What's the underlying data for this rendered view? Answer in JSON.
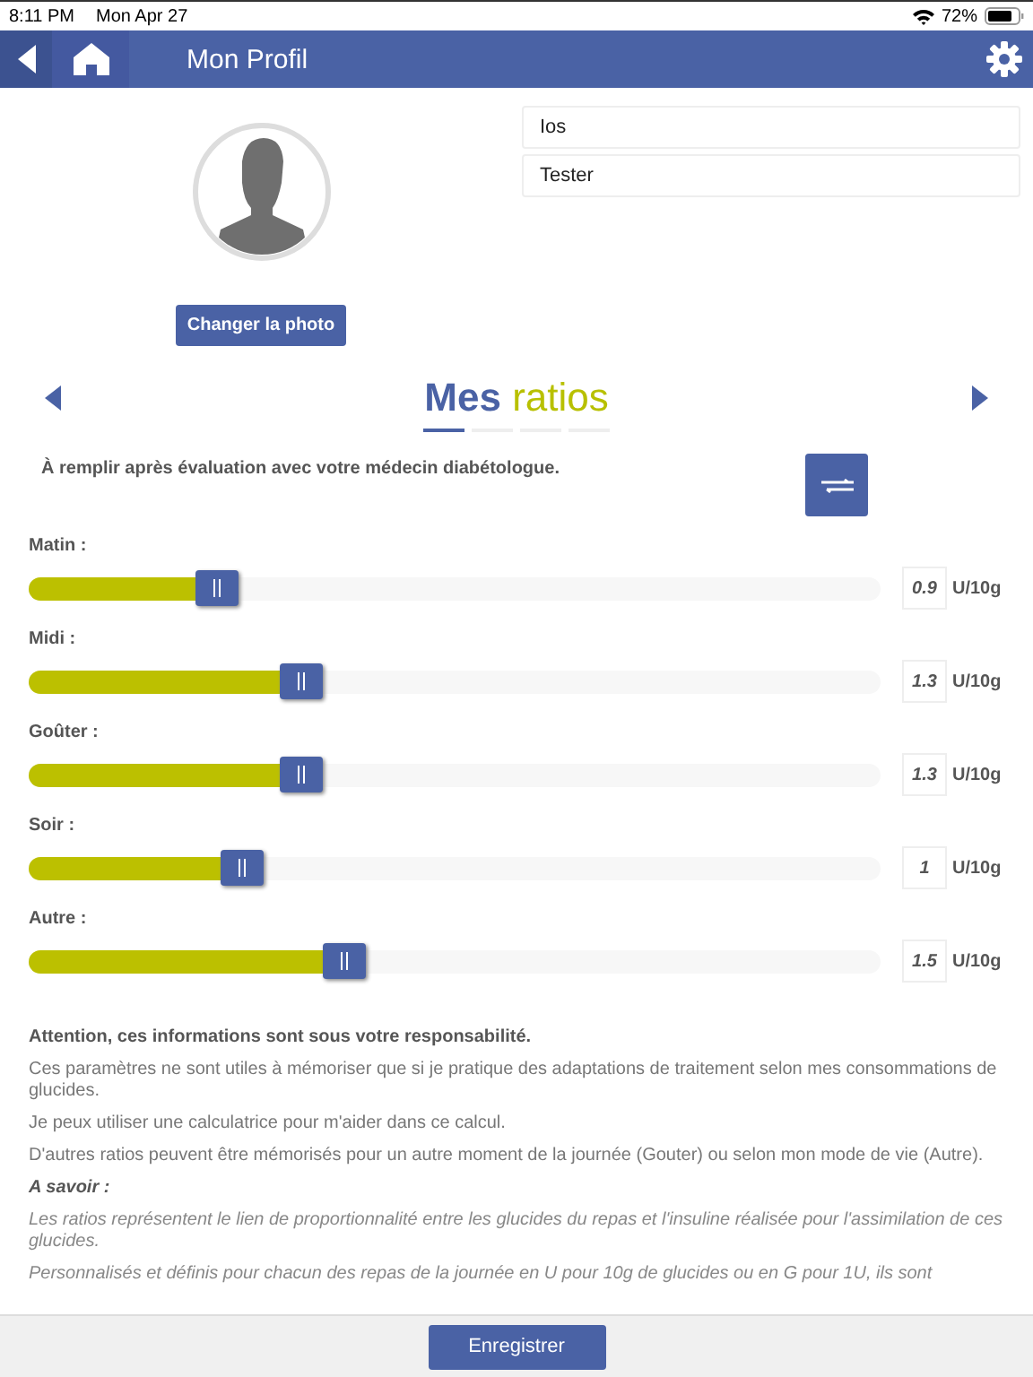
{
  "status_bar": {
    "time": "8:11 PM",
    "date": "Mon Apr 27",
    "battery": "72%"
  },
  "header": {
    "title": "Mon Profil"
  },
  "profile": {
    "change_photo": "Changer la photo",
    "fields": [
      {
        "value": "Ios"
      },
      {
        "value": "Tester"
      }
    ]
  },
  "section": {
    "title_bold": "Mes",
    "title_light": "ratios",
    "pages": [
      {
        "selected": true
      },
      {
        "selected": false
      },
      {
        "selected": false
      },
      {
        "selected": false
      }
    ],
    "instruction": "À remplir après évaluation avec votre médecin diabétologue."
  },
  "ratios": [
    {
      "label": "Matin :",
      "level": 0.22,
      "value": "0.9",
      "unit": "U/10g"
    },
    {
      "label": "Midi :",
      "level": 0.32,
      "value": "1.3",
      "unit": "U/10g"
    },
    {
      "label": "Goûter :",
      "level": 0.32,
      "value": "1.3",
      "unit": "U/10g"
    },
    {
      "label": "Soir :",
      "level": 0.25,
      "value": "1",
      "unit": "U/10g"
    },
    {
      "label": "Autre :",
      "level": 0.37,
      "value": "1.5",
      "unit": "U/10g"
    }
  ],
  "notes": [
    {
      "kind": "warning",
      "text": "Attention, ces informations sont sous votre responsabilité."
    },
    {
      "kind": "plain",
      "text": "Ces paramètres ne sont utiles à mémoriser que si je pratique des adaptations de traitement selon mes consommations de glucides."
    },
    {
      "kind": "plain",
      "text": "Je peux utiliser une calculatrice pour m'aider dans ce calcul."
    },
    {
      "kind": "plain",
      "text": "D'autres ratios peuvent être mémorisés pour un autre moment de la journée (Gouter) ou selon mon mode de vie (Autre)."
    },
    {
      "kind": "heading",
      "text": "A savoir :"
    },
    {
      "kind": "italic",
      "text": "Les ratios représentent le lien de proportionnalité entre les glucides du repas et l'insuline réalisée pour l'assimilation de ces glucides."
    },
    {
      "kind": "italic",
      "text": "Personnalisés et définis pour chacun des repas de la journée en U pour 10g de glucides ou en G pour 1U, ils sont"
    }
  ],
  "footer": {
    "save": "Enregistrer"
  }
}
